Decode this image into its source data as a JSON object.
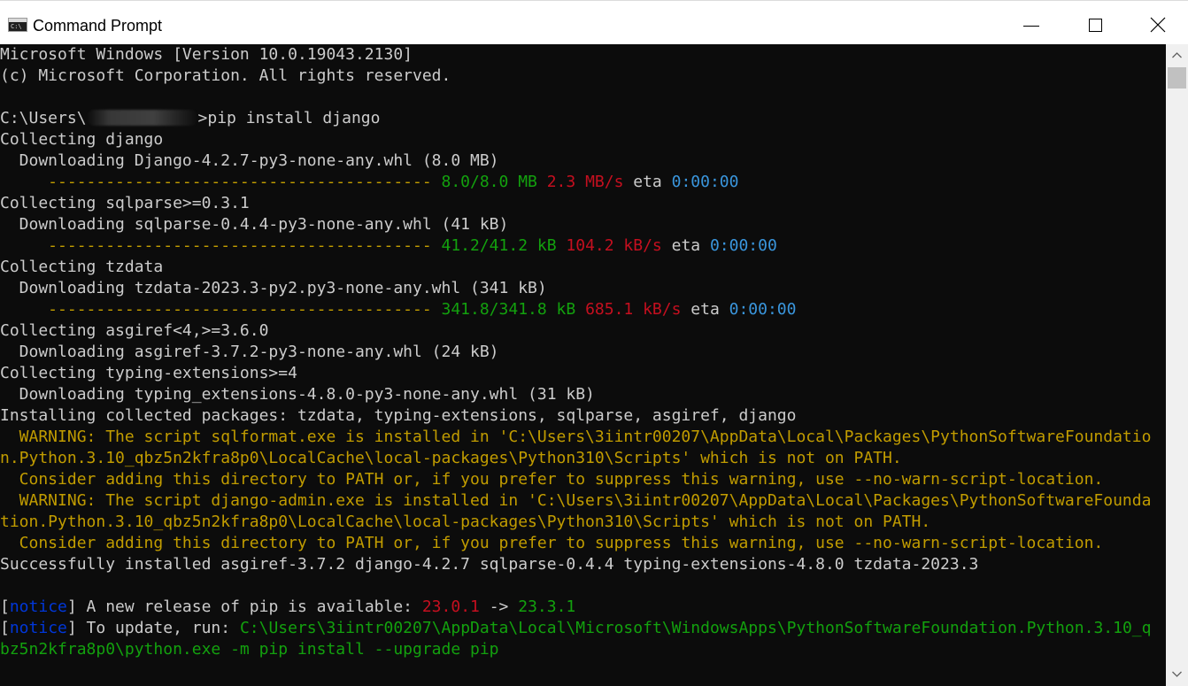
{
  "window": {
    "title": "Command Prompt",
    "icon": "console-app-icon",
    "controls": [
      "minimize-icon",
      "maximize-icon",
      "close-icon"
    ]
  },
  "colors": {
    "background": "#0c0c0c",
    "default_text": "#cccccc",
    "green": "#13a10e",
    "red": "#c50f1f",
    "cyan": "#3a96dd",
    "yellow": "#c19c00",
    "blue": "#0037da",
    "bright_blue": "#3b78ff"
  },
  "console": {
    "lines": [
      {
        "segments": [
          {
            "text": "Microsoft Windows [Version 10.0.19043.2130]",
            "color": "w"
          }
        ]
      },
      {
        "segments": [
          {
            "text": "(c) Microsoft Corporation. All rights reserved.",
            "color": "w"
          }
        ]
      },
      {
        "segments": []
      },
      {
        "segments": [
          {
            "text": "C:\\Users\\",
            "color": "w"
          },
          {
            "redacted": true
          },
          {
            "text": ">pip install django",
            "color": "w"
          }
        ]
      },
      {
        "segments": [
          {
            "text": "Collecting django",
            "color": "w"
          }
        ]
      },
      {
        "segments": [
          {
            "text": "  Downloading Django-4.2.7-py3-none-any.whl (8.0 MB)",
            "color": "w"
          }
        ]
      },
      {
        "segments": [
          {
            "text": "     ---------------------------------------- ",
            "color": "y"
          },
          {
            "text": "8.0/8.0 MB",
            "color": "g"
          },
          {
            "text": " ",
            "color": "w"
          },
          {
            "text": "2.3 MB/s",
            "color": "r"
          },
          {
            "text": " eta ",
            "color": "w"
          },
          {
            "text": "0:00:00",
            "color": "c"
          }
        ]
      },
      {
        "segments": [
          {
            "text": "Collecting sqlparse>=0.3.1",
            "color": "w"
          }
        ]
      },
      {
        "segments": [
          {
            "text": "  Downloading sqlparse-0.4.4-py3-none-any.whl (41 kB)",
            "color": "w"
          }
        ]
      },
      {
        "segments": [
          {
            "text": "     ---------------------------------------- ",
            "color": "y"
          },
          {
            "text": "41.2/41.2 kB",
            "color": "g"
          },
          {
            "text": " ",
            "color": "w"
          },
          {
            "text": "104.2 kB/s",
            "color": "r"
          },
          {
            "text": " eta ",
            "color": "w"
          },
          {
            "text": "0:00:00",
            "color": "c"
          }
        ]
      },
      {
        "segments": [
          {
            "text": "Collecting tzdata",
            "color": "w"
          }
        ]
      },
      {
        "segments": [
          {
            "text": "  Downloading tzdata-2023.3-py2.py3-none-any.whl (341 kB)",
            "color": "w"
          }
        ]
      },
      {
        "segments": [
          {
            "text": "     ---------------------------------------- ",
            "color": "y"
          },
          {
            "text": "341.8/341.8 kB",
            "color": "g"
          },
          {
            "text": " ",
            "color": "w"
          },
          {
            "text": "685.1 kB/s",
            "color": "r"
          },
          {
            "text": " eta ",
            "color": "w"
          },
          {
            "text": "0:00:00",
            "color": "c"
          }
        ]
      },
      {
        "segments": [
          {
            "text": "Collecting asgiref<4,>=3.6.0",
            "color": "w"
          }
        ]
      },
      {
        "segments": [
          {
            "text": "  Downloading asgiref-3.7.2-py3-none-any.whl (24 kB)",
            "color": "w"
          }
        ]
      },
      {
        "segments": [
          {
            "text": "Collecting typing-extensions>=4",
            "color": "w"
          }
        ]
      },
      {
        "segments": [
          {
            "text": "  Downloading typing_extensions-4.8.0-py3-none-any.whl (31 kB)",
            "color": "w"
          }
        ]
      },
      {
        "segments": [
          {
            "text": "Installing collected packages: tzdata, typing-extensions, sqlparse, asgiref, django",
            "color": "w"
          }
        ]
      },
      {
        "segments": [
          {
            "text": "  WARNING: The script sqlformat.exe is installed in 'C:\\Users\\3iintr00207\\AppData\\Local\\Packages\\PythonSoftwareFoundatio",
            "color": "y"
          }
        ]
      },
      {
        "segments": [
          {
            "text": "n.Python.3.10_qbz5n2kfra8p0\\LocalCache\\local-packages\\Python310\\Scripts' which is not on PATH.",
            "color": "y"
          }
        ]
      },
      {
        "segments": [
          {
            "text": "  Consider adding this directory to PATH or, if you prefer to suppress this warning, use --no-warn-script-location.",
            "color": "y"
          }
        ]
      },
      {
        "segments": [
          {
            "text": "  WARNING: The script django-admin.exe is installed in 'C:\\Users\\3iintr00207\\AppData\\Local\\Packages\\PythonSoftwareFounda",
            "color": "y"
          }
        ]
      },
      {
        "segments": [
          {
            "text": "tion.Python.3.10_qbz5n2kfra8p0\\LocalCache\\local-packages\\Python310\\Scripts' which is not on PATH.",
            "color": "y"
          }
        ]
      },
      {
        "segments": [
          {
            "text": "  Consider adding this directory to PATH or, if you prefer to suppress this warning, use --no-warn-script-location.",
            "color": "y"
          }
        ]
      },
      {
        "segments": [
          {
            "text": "Successfully installed asgiref-3.7.2 django-4.2.7 sqlparse-0.4.4 typing-extensions-4.8.0 tzdata-2023.3",
            "color": "w"
          }
        ]
      },
      {
        "segments": []
      },
      {
        "segments": [
          {
            "text": "[",
            "color": "w"
          },
          {
            "text": "notice",
            "color": "b"
          },
          {
            "text": "] A new release of pip is available: ",
            "color": "w"
          },
          {
            "text": "23.0.1",
            "color": "r"
          },
          {
            "text": " -> ",
            "color": "w"
          },
          {
            "text": "23.3.1",
            "color": "g"
          }
        ]
      },
      {
        "segments": [
          {
            "text": "[",
            "color": "w"
          },
          {
            "text": "notice",
            "color": "b"
          },
          {
            "text": "] To update, run: ",
            "color": "w"
          },
          {
            "text": "C:\\Users\\3iintr00207\\AppData\\Local\\Microsoft\\WindowsApps\\PythonSoftwareFoundation.Python.3.10_q",
            "color": "g"
          }
        ]
      },
      {
        "segments": [
          {
            "text": "bz5n2kfra8p0\\python.exe -m pip install --upgrade pip",
            "color": "g"
          }
        ]
      }
    ]
  }
}
